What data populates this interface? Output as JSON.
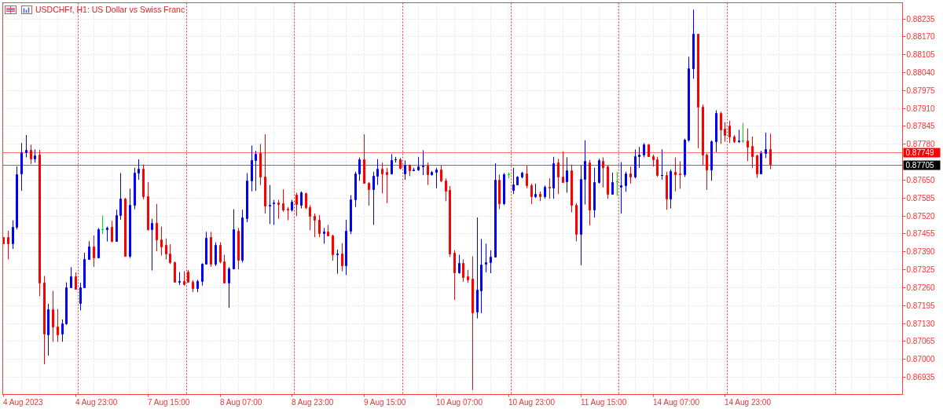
{
  "chart": {
    "title": "USDCHFf, H1:  US Dollar vs Swiss Franc",
    "price_axis": [
      "0.88235",
      "0.88170",
      "0.88105",
      "0.88040",
      "0.87975",
      "0.87910",
      "0.87845",
      "0.87780",
      "0.87650",
      "0.87585",
      "0.87520",
      "0.87455",
      "0.87390",
      "0.87325",
      "0.87260",
      "0.87195",
      "0.87130",
      "0.87065",
      "0.87000",
      "0.86935"
    ],
    "time_axis": [
      "4 Aug 2023",
      "4 Aug 23:00",
      "7 Aug 15:00",
      "8 Aug 07:00",
      "8 Aug 23:00",
      "9 Aug 15:00",
      "10 Aug 07:00",
      "10 Aug 23:00",
      "11 Aug 15:00",
      "14 Aug 07:00",
      "14 Aug 23:00"
    ],
    "price_tags": [
      {
        "label": "0.87749",
        "color": "#ff0000"
      },
      {
        "label": "0.87705",
        "color": "#000000"
      }
    ]
  }
}
